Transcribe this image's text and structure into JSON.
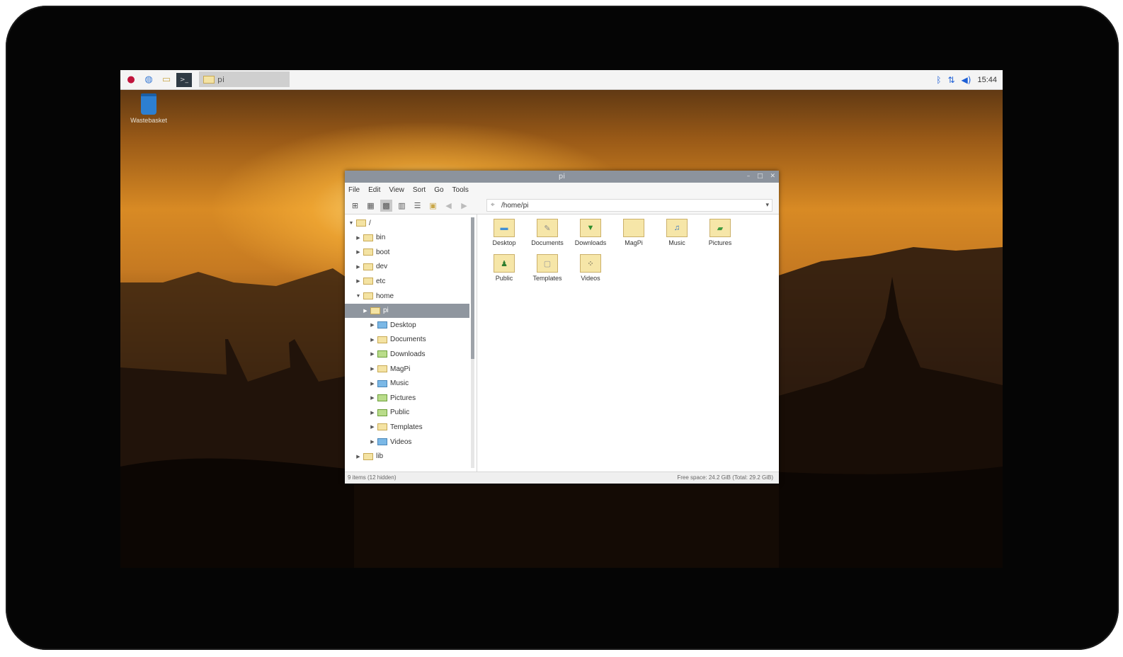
{
  "taskbar": {
    "task_label": "pi",
    "clock": "15:44"
  },
  "desktop": {
    "trash_label": "Wastebasket"
  },
  "window": {
    "title": "pi",
    "menu": [
      "File",
      "Edit",
      "View",
      "Sort",
      "Go",
      "Tools"
    ],
    "address": "/home/pi",
    "tree": [
      {
        "label": "/",
        "level": 0,
        "expanded": true
      },
      {
        "label": "bin",
        "level": 1
      },
      {
        "label": "boot",
        "level": 1
      },
      {
        "label": "dev",
        "level": 1
      },
      {
        "label": "etc",
        "level": 1
      },
      {
        "label": "home",
        "level": 1,
        "expanded": true
      },
      {
        "label": "pi",
        "level": 2,
        "selected": true
      },
      {
        "label": "Desktop",
        "level": 3
      },
      {
        "label": "Documents",
        "level": 3
      },
      {
        "label": "Downloads",
        "level": 3
      },
      {
        "label": "MagPi",
        "level": 3
      },
      {
        "label": "Music",
        "level": 3
      },
      {
        "label": "Pictures",
        "level": 3
      },
      {
        "label": "Public",
        "level": 3
      },
      {
        "label": "Templates",
        "level": 3
      },
      {
        "label": "Videos",
        "level": 3
      },
      {
        "label": "lib",
        "level": 1
      }
    ],
    "items": [
      {
        "label": "Desktop",
        "icon": "desktop-folder-icon"
      },
      {
        "label": "Documents",
        "icon": "documents-folder-icon"
      },
      {
        "label": "Downloads",
        "icon": "downloads-folder-icon"
      },
      {
        "label": "MagPi",
        "icon": "folder-icon"
      },
      {
        "label": "Music",
        "icon": "music-folder-icon"
      },
      {
        "label": "Pictures",
        "icon": "pictures-folder-icon"
      },
      {
        "label": "Public",
        "icon": "public-folder-icon"
      },
      {
        "label": "Templates",
        "icon": "templates-folder-icon"
      },
      {
        "label": "Videos",
        "icon": "videos-folder-icon"
      }
    ],
    "status_left": "9 items (12 hidden)",
    "status_right": "Free space: 24.2 GiB (Total: 29.2 GiB)"
  }
}
